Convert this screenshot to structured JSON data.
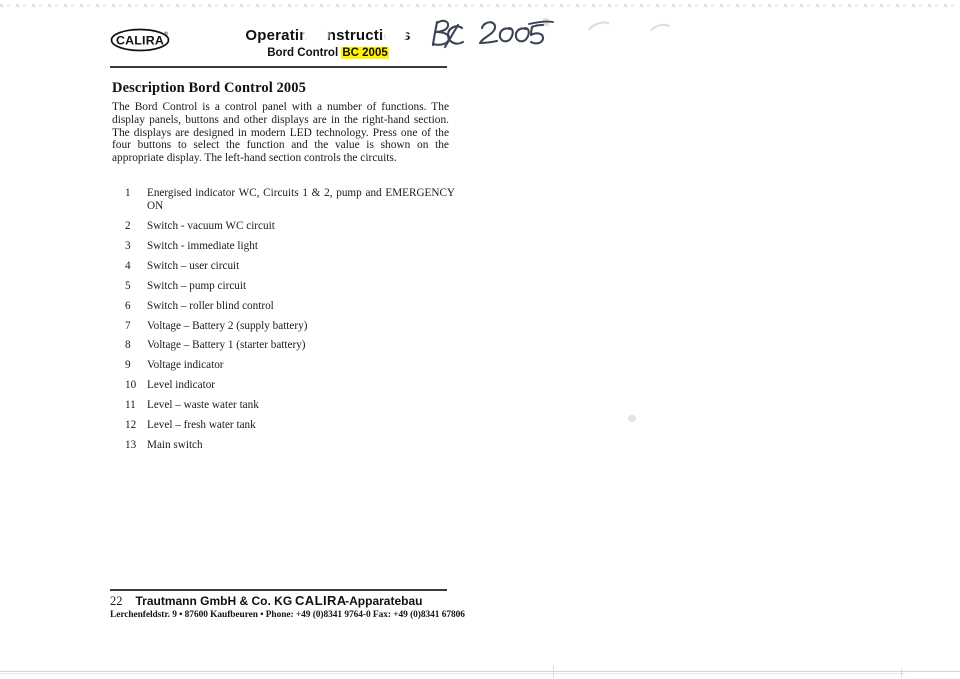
{
  "document": {
    "header": {
      "logo_text": "CALIRA",
      "logo_trademark": "®",
      "title_main": "Operating Instructions",
      "title_sub_prefix": "Bord Control ",
      "title_sub_highlight": "BC 2005",
      "highlight_color": "#fff200"
    },
    "annotation": {
      "handwritten_text": "BC 2005",
      "ink_color": "#3b4356"
    },
    "body": {
      "section_title": "Description Bord Control 2005",
      "intro_paragraph": "The Bord Control is a control panel with a number of functions. The display panels, buttons  and other displays are in the right-hand section. The displays are designed in modern LED technology. Press one of the four buttons to select the function and the value is shown on the appropriate display. The left-hand section controls the circuits."
    },
    "legend": {
      "items": [
        {
          "num": "1",
          "label": "Energised indicator WC, Circuits 1 & 2, pump and EMERGENCY ON"
        },
        {
          "num": "2",
          "label": "Switch - vacuum WC circuit"
        },
        {
          "num": "3",
          "label": "Switch -  immediate light"
        },
        {
          "num": "4",
          "label": "Switch – user circuit"
        },
        {
          "num": "5",
          "label": "Switch – pump circuit"
        },
        {
          "num": "6",
          "label": "Switch – roller blind control"
        },
        {
          "num": "7",
          "label": "Voltage – Battery 2 (supply battery)"
        },
        {
          "num": "8",
          "label": "Voltage – Battery 1 (starter battery)"
        },
        {
          "num": "9",
          "label": "Voltage indicator"
        },
        {
          "num": "10",
          "label": "Level indicator"
        },
        {
          "num": "11",
          "label": "Level – waste water tank"
        },
        {
          "num": "12",
          "label": "Level – fresh water tank"
        },
        {
          "num": "13",
          "label": "Main switch"
        }
      ]
    },
    "footer": {
      "page_number": "22",
      "company_prefix": "Trautmann GmbH & Co. KG ",
      "company_brand": "CALIRA",
      "company_suffix": "-Apparatebau",
      "address_line": "Lerchenfeldstr. 9 • 87600 Kaufbeuren • Phone: +49 (0)8341 9764-0 Fax: +49 (0)8341 67806"
    }
  }
}
